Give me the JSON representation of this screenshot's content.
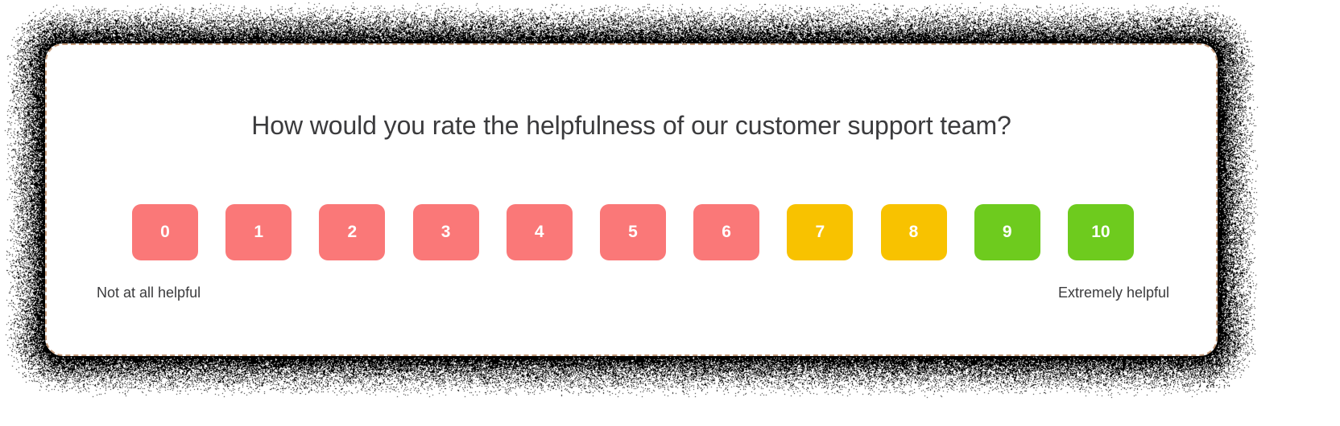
{
  "card": {
    "border_color": "#c49a7a",
    "background": "#ffffff"
  },
  "question": {
    "title": "How would you rate the helpfulness of our customer support team?",
    "title_color": "#3b3b3d"
  },
  "scale": {
    "min": 0,
    "max": 10,
    "options": [
      {
        "value": "0",
        "color": "#fa7878"
      },
      {
        "value": "1",
        "color": "#fa7878"
      },
      {
        "value": "2",
        "color": "#fa7878"
      },
      {
        "value": "3",
        "color": "#fa7878"
      },
      {
        "value": "4",
        "color": "#fa7878"
      },
      {
        "value": "5",
        "color": "#fa7878"
      },
      {
        "value": "6",
        "color": "#fa7878"
      },
      {
        "value": "7",
        "color": "#f8c200"
      },
      {
        "value": "8",
        "color": "#f8c200"
      },
      {
        "value": "9",
        "color": "#6ecb1e"
      },
      {
        "value": "10",
        "color": "#6ecb1e"
      }
    ],
    "label_text_color": "#ffffff"
  },
  "anchors": {
    "low": "Not at all helpful",
    "high": "Extremely helpful"
  }
}
